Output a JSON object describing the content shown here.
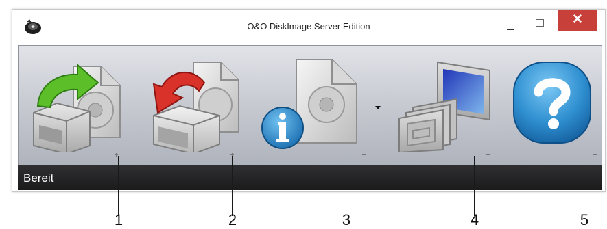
{
  "window": {
    "title": "O&O DiskImage Server Edition",
    "close_symbol": "✕"
  },
  "toolbar": {
    "buttons": [
      {
        "name": "backup",
        "icon": "drive-backup-icon",
        "callout": "1"
      },
      {
        "name": "restore",
        "icon": "drive-restore-icon",
        "callout": "2"
      },
      {
        "name": "image-info",
        "icon": "image-info-icon",
        "callout": "3",
        "has_dropdown": true
      },
      {
        "name": "mount-image",
        "icon": "virtual-drive-monitor-icon",
        "callout": "4"
      },
      {
        "name": "help",
        "icon": "help-question-icon",
        "callout": "5"
      }
    ]
  },
  "statusbar": {
    "text": "Bereit"
  },
  "callouts": [
    "1",
    "2",
    "3",
    "4",
    "5"
  ],
  "colors": {
    "close_red": "#c7403a",
    "help_blue": "#2f8fd0",
    "backup_green": "#5cbf2a",
    "restore_red": "#d8322b",
    "status_bg": "#1b1b1c"
  }
}
